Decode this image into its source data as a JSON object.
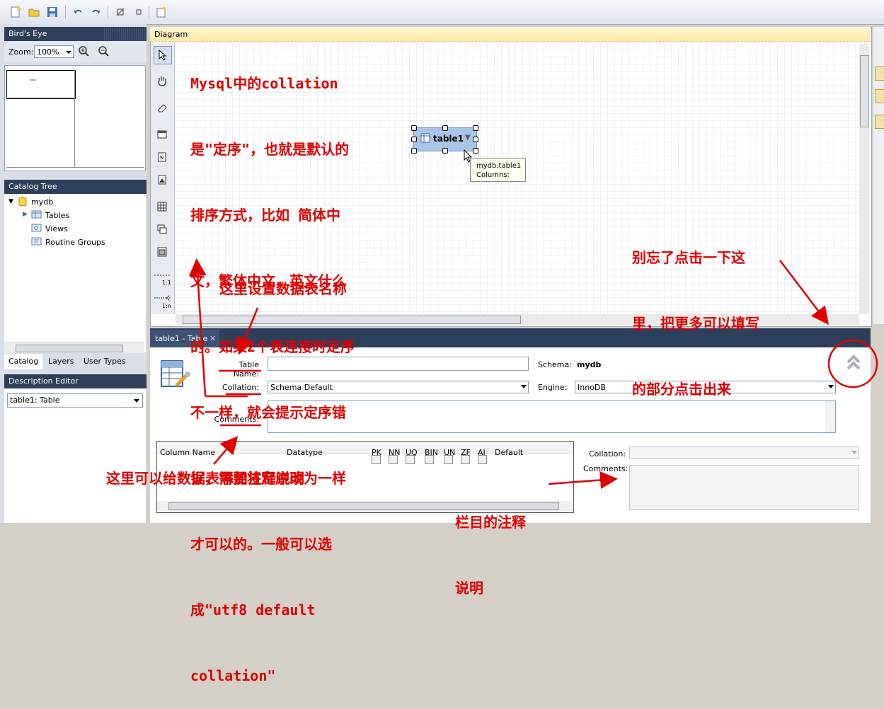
{
  "toolbar": {
    "icons": [
      "new-file-icon",
      "open-folder-icon",
      "save-icon",
      "undo-icon",
      "redo-icon",
      "toggle-grid-icon",
      "align-grid-icon",
      "new-diagram-icon"
    ]
  },
  "birds_eye": {
    "title": "Bird's Eye",
    "zoom_label": "Zoom:",
    "zoom_value": "100%"
  },
  "catalog_tree": {
    "title": "Catalog Tree",
    "root": "mydb",
    "items": [
      "Tables",
      "Views",
      "Routine Groups"
    ]
  },
  "left_tabs": [
    "Catalog",
    "Layers",
    "User Types"
  ],
  "description_editor": {
    "title": "Description Editor",
    "selected": "table1: Table"
  },
  "diagram": {
    "tab_label": "Diagram",
    "table_name": "table1",
    "tooltip_line1": "mydb.table1",
    "tooltip_line2": "Columns:"
  },
  "editor": {
    "tab_label": "table1 - Table",
    "table_name_label": "Table Name:",
    "table_name_value": "",
    "schema_label": "Schema:",
    "schema_value": "mydb",
    "collation_label": "Collation:",
    "collation_value": "Schema Default",
    "engine_label": "Engine:",
    "engine_value": "InnoDB",
    "comments_label": "Comments:",
    "columns": {
      "column_name": "Column Name",
      "datatype": "Datatype",
      "pk": "PK",
      "nn": "NN",
      "uq": "UQ",
      "bin": "BIN",
      "un": "UN",
      "zf": "ZF",
      "ai": "AI",
      "default": "Default"
    },
    "col_collation_label": "Collation:",
    "col_comments_label": "Comments:"
  },
  "annotations": {
    "main_note": [
      "Mysql中的collation",
      "是\"定序\"，也就是默认的",
      "排序方式，比如 简体中",
      "文，繁体中文，英文什么",
      "的。如果2个表连接时定序",
      "不一样，就会提示定序错",
      "误，需要将定序改为一样",
      "才可以的。一般可以选",
      "成\"utf8 default",
      "collation\""
    ],
    "name_note": "这里设置数据表名称",
    "expand_note": [
      "别忘了点击一下这",
      "里，把更多可以填写",
      "的部分点击出来"
    ],
    "comment_note": "这里可以给数据表添加注释说明",
    "column_comment_note": [
      "栏目的注释",
      "说明"
    ]
  },
  "colors": {
    "annotation": "#e00000",
    "panel_header": "#2e3f5c",
    "table_box": "#a9c6e8"
  }
}
